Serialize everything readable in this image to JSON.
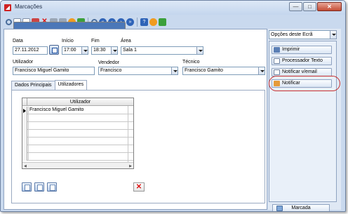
{
  "window": {
    "title": "Marcações",
    "controls": [
      "—",
      "□",
      "✕"
    ]
  },
  "toolbar": {
    "icons": [
      "search-icon",
      "new-doc-icon",
      "doc-icon",
      "calendar-icon",
      "delete-icon",
      "copy-icon",
      "grid-icon",
      "print-icon",
      "attach-icon",
      "refresh-icon",
      "find-icon",
      "nav-first-icon",
      "nav-prev-icon",
      "nav-next-icon",
      "nav-last-icon",
      "help-icon",
      "settings-icon",
      "exit-icon"
    ]
  },
  "form": {
    "data_label": "Data",
    "data_value": "27.11.2012",
    "inicio_label": "Início",
    "inicio_value": "17:00",
    "fim_label": "Fim",
    "fim_value": "18:30",
    "area_label": "Área",
    "area_value": "Sala 1",
    "utilizador_label": "Utilizador",
    "utilizador_value": "Francisco Miguel Gamito",
    "vendedor_label": "Vendedor",
    "vendedor_value": "Francisco",
    "tecnico_label": "Técnico",
    "tecnico_value": "Francisco Gamito"
  },
  "tabs": [
    {
      "label": "Dados Principais",
      "active": false
    },
    {
      "label": "Utilizadores",
      "active": true
    }
  ],
  "grid": {
    "column": "Utilizador",
    "rows": [
      "Francisco Miguel Gamito"
    ]
  },
  "side": {
    "options_label": "Opções deste Ecrã",
    "buttons": [
      "Imprimir",
      "Processador Texto",
      "Notificar v/email",
      "Notificar"
    ],
    "marcada_label": "Marcada"
  }
}
